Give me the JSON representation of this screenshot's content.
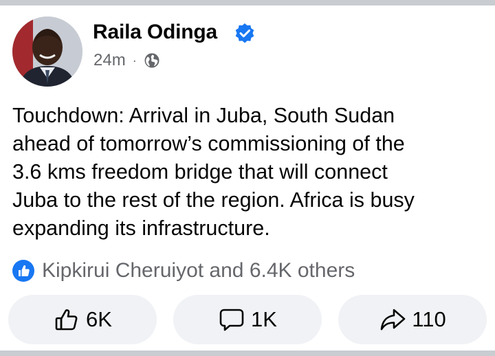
{
  "post": {
    "author": "Raila Odinga",
    "time": "24m",
    "separator": "·",
    "privacy_icon": "globe-icon",
    "verified_icon": "verified-badge-icon",
    "text": "Touchdown: Arrival in Juba, South Sudan\nahead of tomorrow’s commissioning of the\n3.6 kms freedom bridge that will connect\nJuba to the rest of the region. Africa is busy\nexpanding its infrastructure."
  },
  "reactions": {
    "icon": "like-badge-icon",
    "summary": "Kipkirui Cheruiyot and 6.4K others"
  },
  "actions": {
    "like_count": "6K",
    "comment_count": "1K",
    "share_count": "110"
  },
  "colors": {
    "brand_blue": "#1877f2",
    "text": "#050505",
    "secondary_text": "#65676b",
    "button_bg": "#f0f2f5"
  }
}
